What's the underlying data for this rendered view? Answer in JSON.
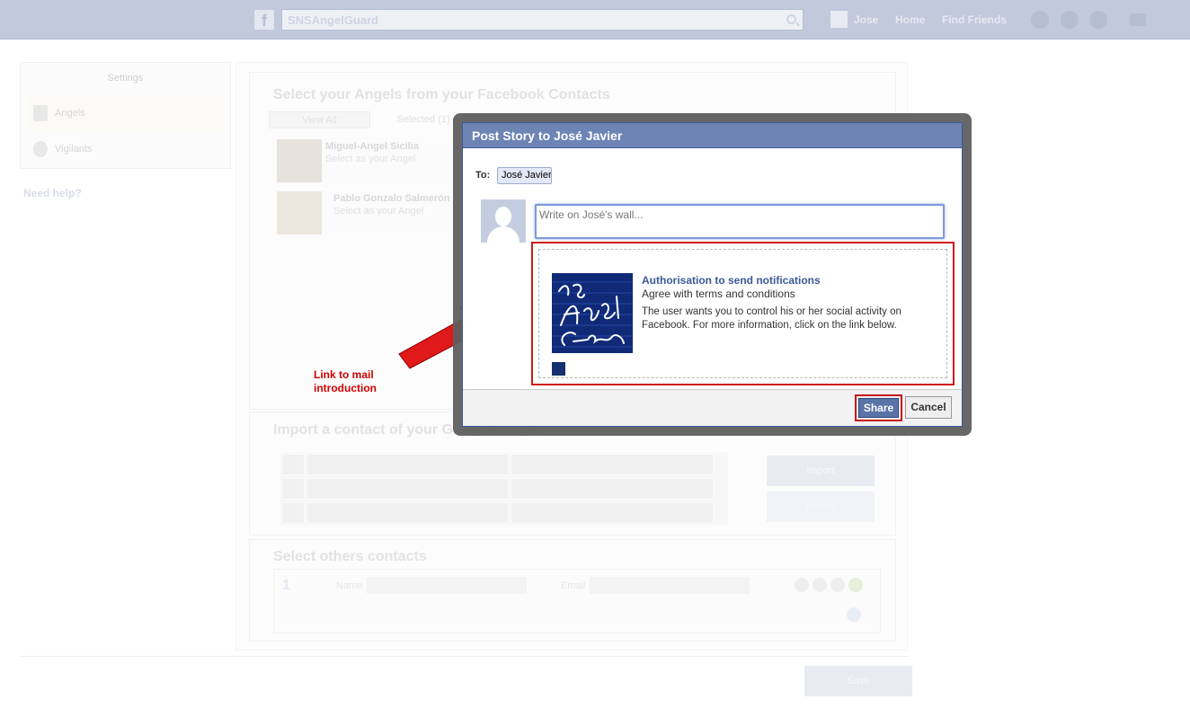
{
  "topbar": {
    "logo_letter": "f",
    "search_value": "SNSAngelGuard",
    "user_name": "Jose",
    "home_label": "Home",
    "find_friends_label": "Find Friends"
  },
  "sidebar": {
    "title": "Settings",
    "items": [
      {
        "label": "Angels",
        "icon": "angel-icon"
      },
      {
        "label": "Vigilants",
        "icon": "vigilant-icon"
      }
    ],
    "need_help": "Need help?"
  },
  "main": {
    "angels_section": {
      "title": "Select your Angels from your Facebook Contacts",
      "tabs": [
        "View All",
        "Selected (1)"
      ],
      "contacts": [
        {
          "name": "Miguel-Angel Sicilia",
          "subtitle": "Select as your Angel"
        },
        {
          "name": "Pablo Gonzalo Salmerón",
          "subtitle": "Select as your Angel"
        }
      ]
    },
    "import_section": {
      "title": "Import a contact of your Gmail account",
      "import_label": "Import",
      "delete_label": "Delete"
    },
    "others_section": {
      "title": "Select others contacts",
      "row_number": "1",
      "name_label": "Name",
      "email_label": "Email"
    },
    "save_label": "Save"
  },
  "annotation": {
    "line1": "Link to mail",
    "line2": "introduction",
    "color": "#d10000"
  },
  "dialog": {
    "title": "Post Story to José Javier",
    "to_label": "To:",
    "to_value": "José Javier",
    "wall_placeholder": "Write on José's wall...",
    "attachment": {
      "title": "Authorisation to send notifications",
      "caption": "Agree with terms and conditions",
      "description": "The user wants you to control his or her social activity on Facebook. For more information, click on the link below."
    },
    "share_label": "Share",
    "cancel_label": "Cancel"
  },
  "colors": {
    "facebook_blue": "#3b5998",
    "dialog_header": "#6d84b4",
    "highlight_red": "#d11a1a"
  }
}
